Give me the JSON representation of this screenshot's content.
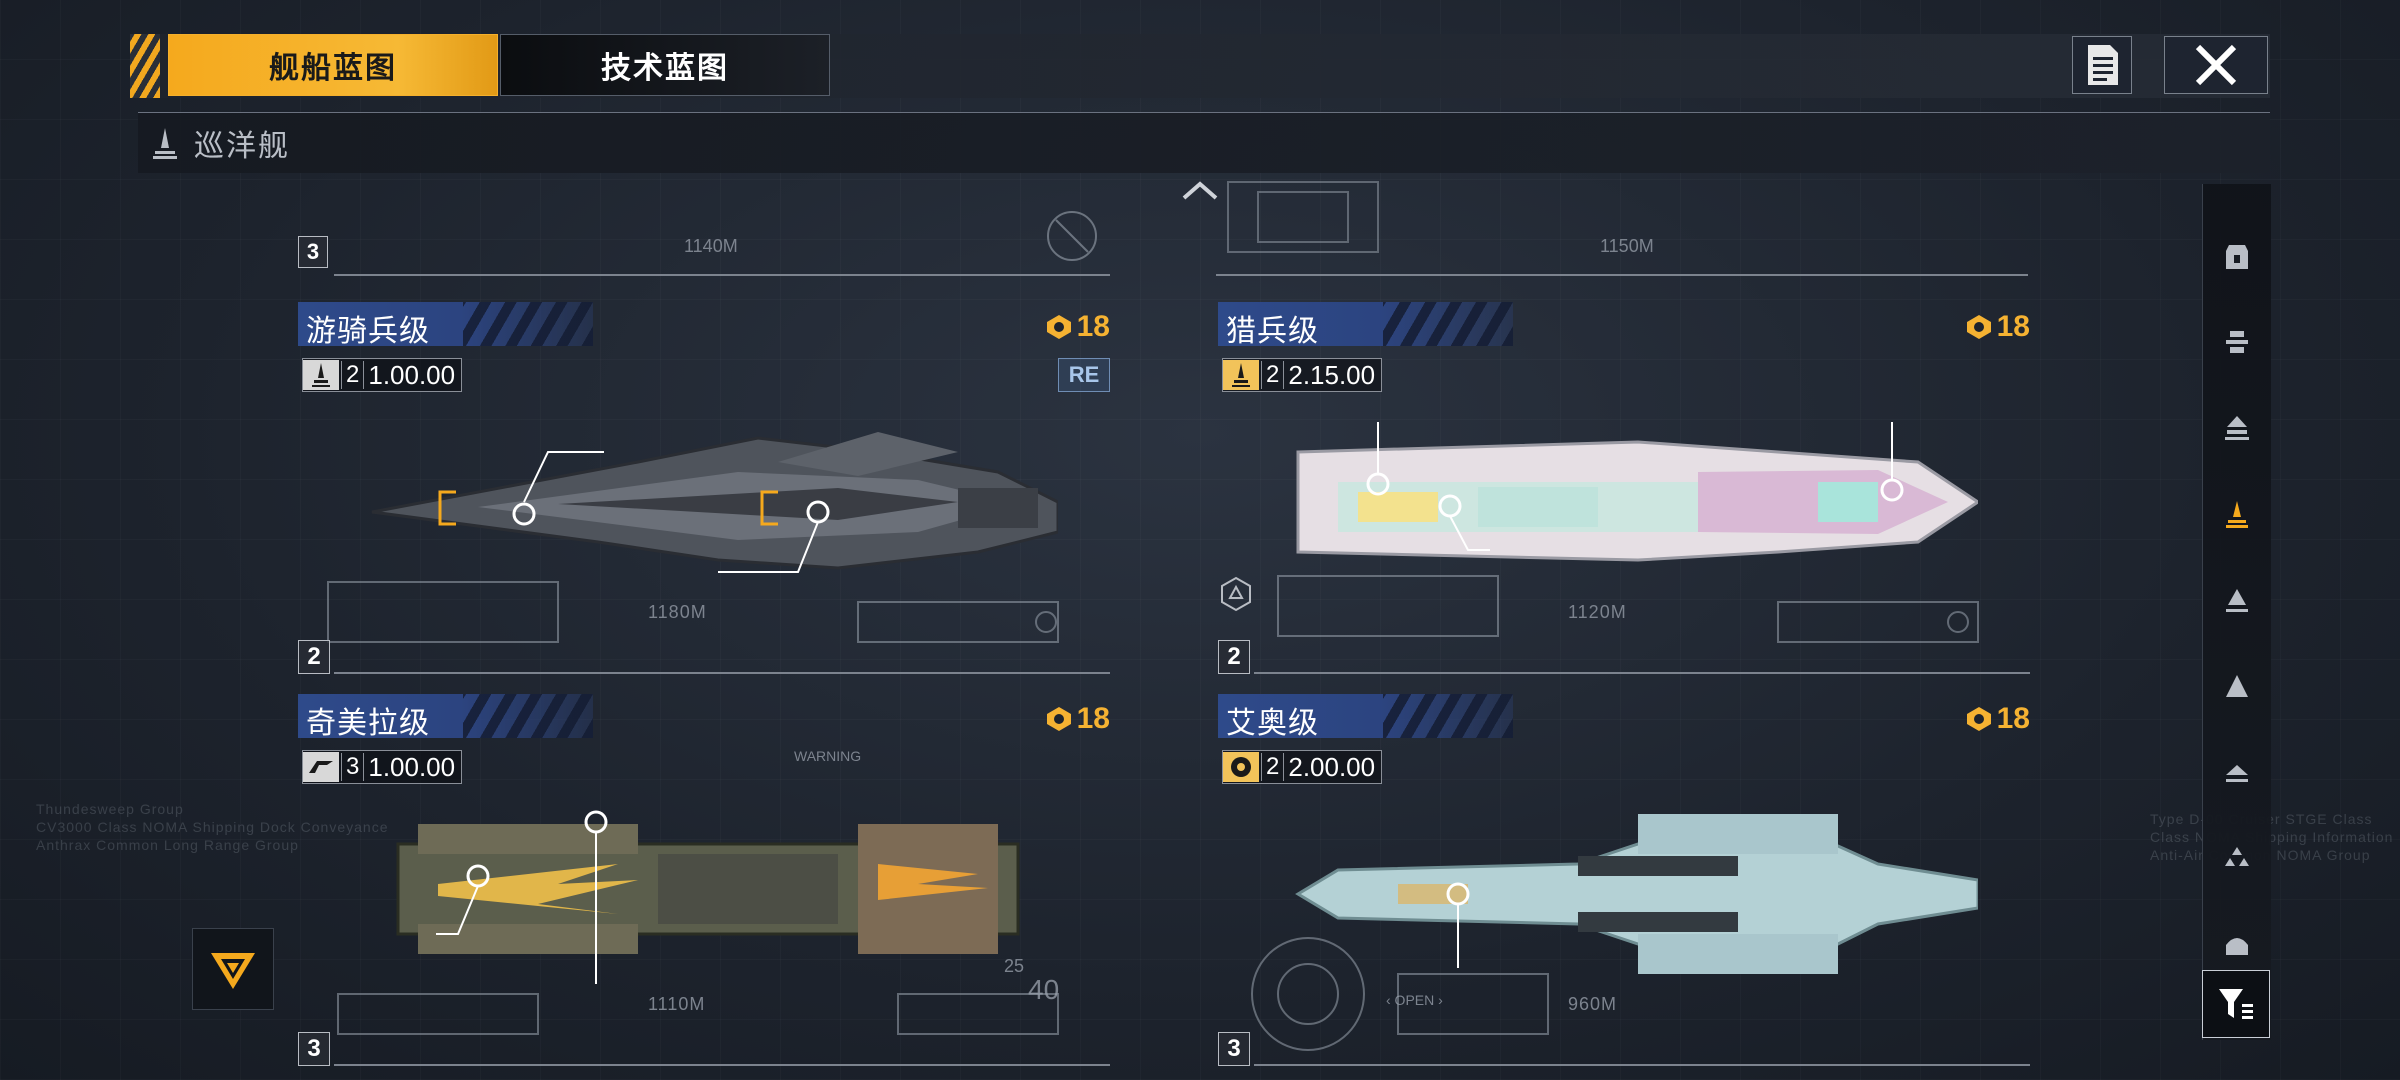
{
  "tabs": {
    "ship_blueprint": "舰船蓝图",
    "tech_blueprint": "技术蓝图"
  },
  "category": {
    "label": "巡洋舰"
  },
  "top_partial": {
    "length_left": "1140M",
    "length_right": "1150M",
    "level_left": "3"
  },
  "cards": [
    {
      "name": "游骑兵级",
      "count": "18",
      "tier": "2",
      "version": "1.00.00",
      "re_tag": "RE",
      "level": "2",
      "length": "1180M",
      "accent": "#5a5f68"
    },
    {
      "name": "猎兵级",
      "count": "18",
      "tier": "2",
      "version": "2.15.00",
      "level": "2",
      "length": "1120M",
      "accent": "#e8cfe0"
    },
    {
      "name": "奇美拉级",
      "count": "18",
      "tier": "3",
      "version": "1.00.00",
      "level": "3",
      "length": "1110M",
      "accent": "#8a7a5a"
    },
    {
      "name": "艾奥级",
      "count": "18",
      "tier": "2",
      "version": "2.00.00",
      "level": "3",
      "length": "960M",
      "accent": "#a9c6cc"
    }
  ],
  "colors": {
    "accent_orange": "#f5a91d",
    "name_bar_blue": "#2e4a8a",
    "count_gold": "#f5b232"
  },
  "sidebar_icons": [
    "carrier-icon",
    "battleship-icon",
    "battlecruiser-icon",
    "cruiser-icon",
    "destroyer-icon",
    "frigate-icon",
    "corvette-icon",
    "fighter-group-icon",
    "auxiliary-icon"
  ],
  "decor": {
    "warning": "WARNING",
    "open": "‹ OPEN ›",
    "number_40": "40",
    "number_25": "25"
  }
}
